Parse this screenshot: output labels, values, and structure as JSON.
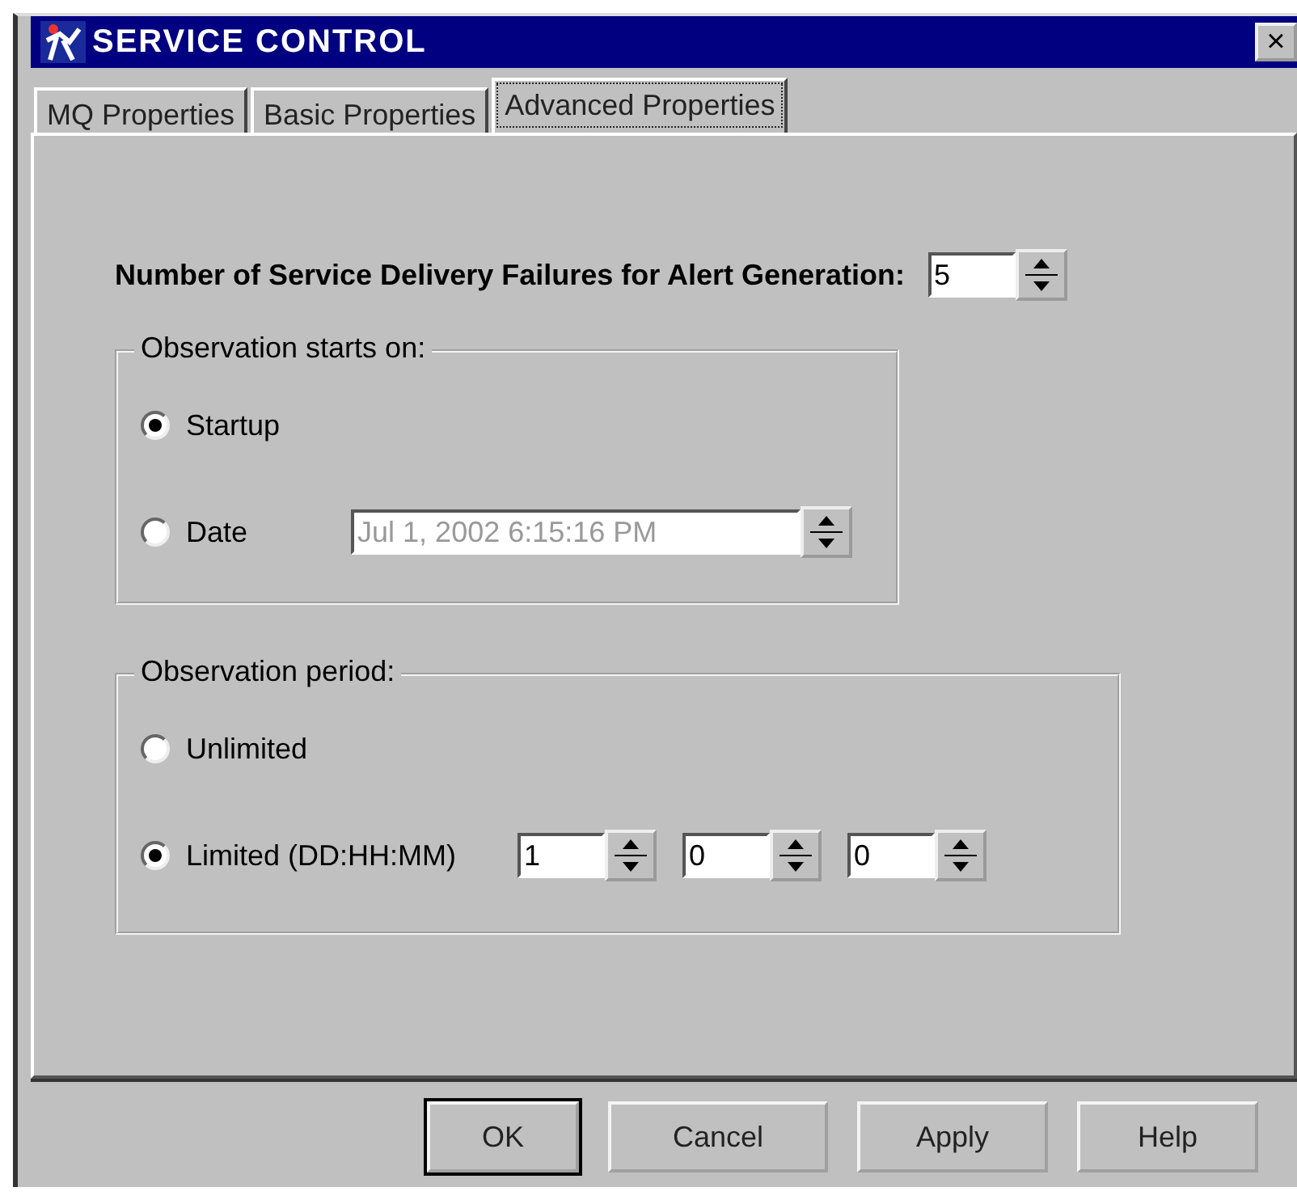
{
  "window": {
    "title": "SERVICE CONTROL",
    "close": "×"
  },
  "tabs": [
    {
      "label": "MQ Properties",
      "selected": false
    },
    {
      "label": "Basic Properties",
      "selected": false
    },
    {
      "label": "Advanced Properties",
      "selected": true
    }
  ],
  "failures": {
    "label": "Number of Service Delivery Failures for Alert Generation:",
    "value": "5"
  },
  "groups": [
    {
      "title": "Observation starts on:",
      "options": [
        {
          "label": "Startup",
          "selected": true
        },
        {
          "label": "Date",
          "selected": false,
          "spinners": [
            {
              "value": "Jul 1, 2002 6:15:16 PM",
              "disabled": true
            }
          ]
        }
      ]
    },
    {
      "title": "Observation period:",
      "options": [
        {
          "label": "Unlimited",
          "selected": false
        },
        {
          "label": "Limited (DD:HH:MM)",
          "selected": true,
          "spinners": [
            {
              "value": "1",
              "disabled": false
            },
            {
              "value": "0",
              "disabled": false
            },
            {
              "value": "0",
              "disabled": false
            }
          ]
        }
      ]
    }
  ],
  "buttons": [
    {
      "label": "OK",
      "default": true
    },
    {
      "label": "Cancel",
      "default": false
    },
    {
      "label": "Apply",
      "default": false
    },
    {
      "label": "Help",
      "default": false
    }
  ]
}
